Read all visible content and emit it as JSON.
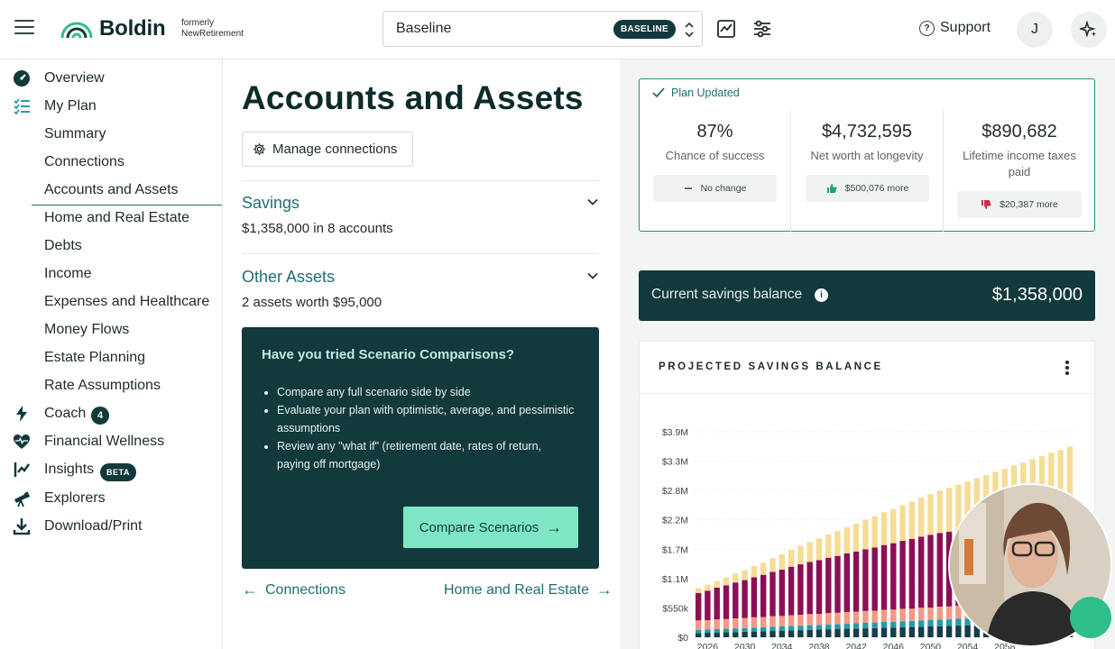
{
  "topbar": {
    "logo_text": "Boldin",
    "formerly_line1": "formerly",
    "formerly_line2": "NewRetirement",
    "scenario_name": "Baseline",
    "scenario_badge": "BASELINE",
    "support_label": "Support",
    "avatar_initial": "J"
  },
  "sidebar": {
    "overview": "Overview",
    "my_plan": "My Plan",
    "summary": "Summary",
    "connections": "Connections",
    "accounts_assets": "Accounts and Assets",
    "home_real_estate": "Home and Real Estate",
    "debts": "Debts",
    "income": "Income",
    "expenses_healthcare": "Expenses and Healthcare",
    "money_flows": "Money Flows",
    "estate_planning": "Estate Planning",
    "rate_assumptions": "Rate Assumptions",
    "coach": "Coach",
    "coach_count": "4",
    "financial_wellness": "Financial Wellness",
    "insights": "Insights",
    "insights_badge": "BETA",
    "explorers": "Explorers",
    "download_print": "Download/Print"
  },
  "main": {
    "title": "Accounts and Assets",
    "manage_connections": "Manage connections",
    "savings": {
      "title": "Savings",
      "subtitle": "$1,358,000 in 8 accounts"
    },
    "other_assets": {
      "title": "Other Assets",
      "subtitle": "2 assets worth $95,000"
    },
    "promo": {
      "title": "Have you tried Scenario Comparisons?",
      "bullets": [
        "Compare any full scenario side by side",
        "Evaluate your plan with optimistic, average, and pessimistic assumptions",
        "Review any \"what if\" (retirement date, rates of return, paying off mortgage)"
      ],
      "button": "Compare Scenarios"
    },
    "prev_link": "Connections",
    "next_link": "Home and Real Estate"
  },
  "right": {
    "plan_updated": "Plan Updated",
    "stats": [
      {
        "value": "87%",
        "caption": "Chance of success",
        "chip": "No change",
        "chip_icon": "minus-icon"
      },
      {
        "value": "$4,732,595",
        "caption": "Net worth at longevity",
        "chip": "$500,076 more",
        "chip_icon": "thumbs-up-icon"
      },
      {
        "value": "$890,682",
        "caption": "Lifetime income taxes paid",
        "chip": "$20,387 more",
        "chip_icon": "thumbs-down-icon"
      }
    ],
    "balance_label": "Current savings balance",
    "balance_amount": "$1,358,000",
    "chart_title": "PROJECTED SAVINGS BALANCE"
  },
  "colors": {
    "brand_dark": "#12393b",
    "link_teal": "#1f6e74",
    "accent_green": "#7ee6c4",
    "series_top": "#f6dc95",
    "series_magenta": "#8c0f55",
    "series_salmon": "#f29a86",
    "series_teal": "#2a9aa6",
    "series_navy": "#163d4a"
  },
  "chart_data": {
    "type": "bar",
    "stacked": true,
    "yticks": [
      "$3.9M",
      "$3.3M",
      "$2.8M",
      "$2.2M",
      "$1.7M",
      "$1.1M",
      "$550k",
      "$0"
    ],
    "ylim": [
      0,
      3900000
    ],
    "xticks": [
      "2026",
      "2030",
      "2034",
      "2038",
      "2042",
      "2046",
      "2050",
      "2054",
      "2058"
    ],
    "x": [
      2025,
      2026,
      2027,
      2028,
      2029,
      2030,
      2031,
      2032,
      2033,
      2034,
      2035,
      2036,
      2037,
      2038,
      2039,
      2040,
      2041,
      2042,
      2043,
      2044,
      2045,
      2046,
      2047,
      2048,
      2049,
      2050,
      2051,
      2052,
      2053,
      2054,
      2055,
      2056,
      2057,
      2058,
      2059,
      2060,
      2061,
      2062,
      2063,
      2064,
      2065
    ],
    "series": [
      {
        "values": [
          80000,
          85000,
          90000,
          95000,
          100000,
          105000,
          110000,
          115000,
          120000,
          125000,
          130000,
          135000,
          140000,
          145000,
          150000,
          155000,
          160000,
          165000,
          170000,
          175000,
          180000,
          185000,
          190000,
          195000,
          200000,
          205000,
          210000,
          215000,
          220000,
          225000,
          230000,
          235000,
          240000,
          245000,
          250000,
          255000,
          260000,
          265000,
          270000,
          275000,
          280000
        ]
      },
      {
        "values": [
          60000,
          60000,
          65000,
          65000,
          70000,
          70000,
          75000,
          75000,
          80000,
          80000,
          85000,
          85000,
          90000,
          90000,
          95000,
          95000,
          100000,
          100000,
          105000,
          105000,
          110000,
          110000,
          115000,
          115000,
          120000,
          120000,
          125000,
          125000,
          130000,
          130000,
          135000,
          135000,
          140000,
          140000,
          145000,
          145000,
          150000,
          150000,
          155000,
          155000,
          160000
        ]
      },
      {
        "values": [
          180000,
          180000,
          185000,
          185000,
          190000,
          190000,
          195000,
          195000,
          200000,
          200000,
          205000,
          205000,
          210000,
          210000,
          215000,
          215000,
          220000,
          220000,
          225000,
          225000,
          230000,
          230000,
          235000,
          235000,
          240000,
          240000,
          245000,
          245000,
          250000,
          250000,
          255000,
          255000,
          260000,
          260000,
          265000,
          265000,
          270000,
          270000,
          275000,
          275000,
          280000
        ]
      },
      {
        "values": [
          520000,
          560000,
          600000,
          640000,
          680000,
          720000,
          760000,
          800000,
          840000,
          880000,
          920000,
          960000,
          990000,
          1020000,
          1050000,
          1080000,
          1110000,
          1140000,
          1170000,
          1200000,
          1230000,
          1260000,
          1290000,
          1320000,
          1350000,
          1380000,
          1400000,
          1420000,
          1440000,
          1460000,
          1480000,
          1500000,
          1520000,
          1540000,
          1560000,
          1580000,
          1600000,
          1620000,
          1640000,
          1660000,
          1680000
        ]
      },
      {
        "values": [
          90000,
          110000,
          130000,
          150000,
          170000,
          190000,
          210000,
          230000,
          260000,
          290000,
          320000,
          350000,
          380000,
          410000,
          440000,
          470000,
          500000,
          530000,
          560000,
          590000,
          620000,
          650000,
          680000,
          710000,
          740000,
          770000,
          800000,
          830000,
          860000,
          890000,
          920000,
          950000,
          980000,
          1010000,
          1040000,
          1070000,
          1100000,
          1130000,
          1160000,
          1190000,
          1220000
        ]
      }
    ]
  }
}
